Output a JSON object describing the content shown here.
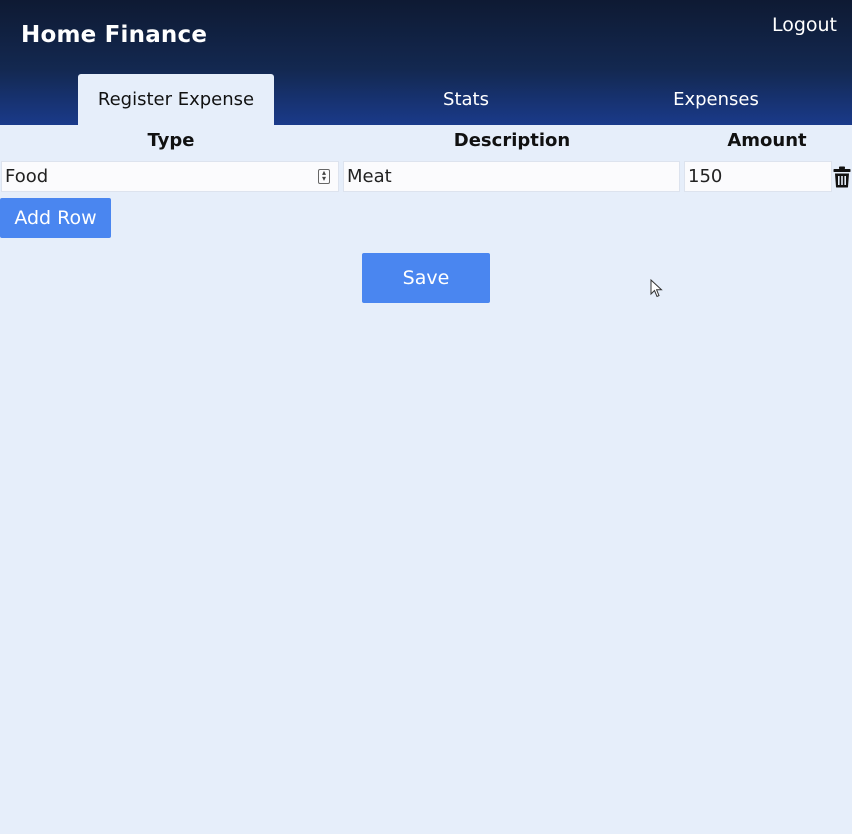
{
  "app": {
    "title": "Home Finance"
  },
  "header": {
    "logout_label": "Logout"
  },
  "tabs": [
    {
      "label": "Register Expense",
      "active": true
    },
    {
      "label": "Stats",
      "active": false
    },
    {
      "label": "Expenses",
      "active": false
    }
  ],
  "table": {
    "columns": [
      "Type",
      "Description",
      "Amount"
    ],
    "rows": [
      {
        "type": "Food",
        "description": "Meat",
        "amount": "150"
      }
    ]
  },
  "buttons": {
    "add_row_label": "Add Row",
    "save_label": "Save"
  },
  "colors": {
    "header_dark": "#0e1a33",
    "header_blue": "#1a3a8a",
    "page_bg": "#e6eefa",
    "button_blue": "#4a86f0"
  },
  "icons": {
    "row_delete": "trash-icon",
    "type_select": "select-arrows-icon"
  }
}
